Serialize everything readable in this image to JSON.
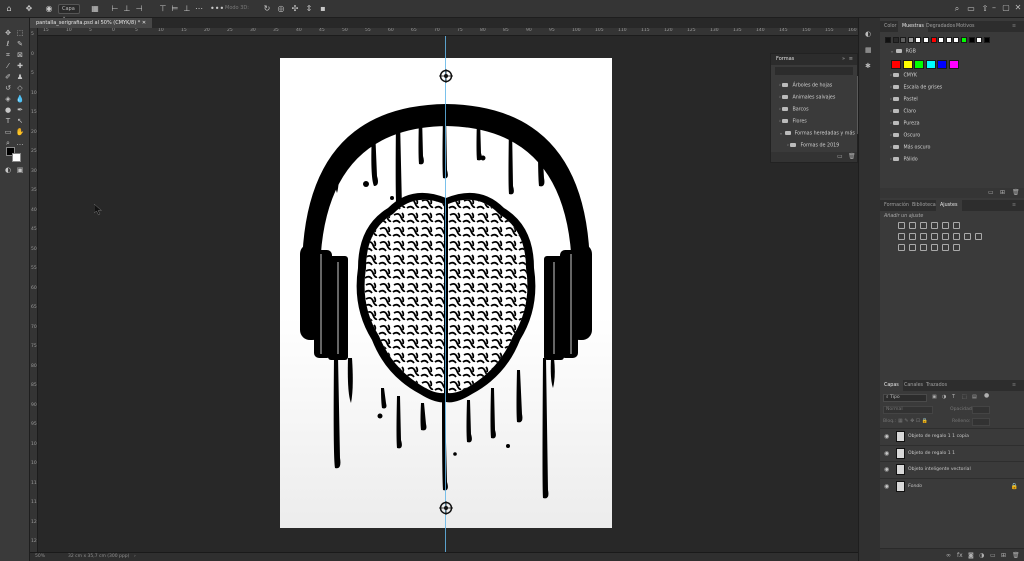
{
  "options_bar": {
    "layer_select": "Capa",
    "mode_3d": "Modo 3D:"
  },
  "document": {
    "tab_title": "pantalla_serigrafia.psd al 50% (CMYK/8) *",
    "zoom": "50%",
    "doc_info": "32 cm x 35,7 cm (300 ppp)"
  },
  "ruler_h": [
    "15",
    "10",
    "5",
    "0",
    "5",
    "10",
    "15",
    "20",
    "25",
    "30",
    "35",
    "40",
    "45",
    "50",
    "55",
    "60",
    "65",
    "70",
    "75",
    "80",
    "85",
    "90",
    "95",
    "100",
    "105",
    "110",
    "115",
    "120",
    "125",
    "130",
    "135",
    "140",
    "145",
    "150",
    "155",
    "160"
  ],
  "ruler_v": [
    "5",
    "0",
    "5",
    "10",
    "15",
    "20",
    "25",
    "30",
    "35",
    "40",
    "45",
    "50",
    "55",
    "60",
    "65",
    "70",
    "75",
    "80",
    "85",
    "90",
    "95",
    "100",
    "105",
    "110",
    "115",
    "120",
    "125"
  ],
  "formas_panel": {
    "title": "Formas",
    "items": [
      "Árboles de hojas",
      "Animales salvajes",
      "Barcos",
      "Flores",
      "Formas heredadas y más",
      "Formas de 2019"
    ]
  },
  "swatches_panel": {
    "tabs": [
      "Color",
      "Muestras",
      "Degradados",
      "Motivos"
    ],
    "active_tab": "Muestras",
    "recent_colors": [
      "#111111",
      "#2a2a2a",
      "#606060",
      "#9a9a9a",
      "#ffffff",
      "#ffffff",
      "#ff0000",
      "#ffffff",
      "#ffffff",
      "#ffffff",
      "#00ff00",
      "#000000",
      "#ffffff",
      "#000000"
    ],
    "rgb_group": "RGB",
    "rgb_colors": [
      "#ff0000",
      "#ffff00",
      "#00ff00",
      "#00ffff",
      "#0000ff",
      "#ff00ff"
    ],
    "groups": [
      "CMYK",
      "Escala de grises",
      "Pastel",
      "Claro",
      "Pureza",
      "Oscuro",
      "Más oscuro",
      "Pálido"
    ]
  },
  "adjust_panel": {
    "tabs": [
      "Formación",
      "Bibliotecas",
      "Ajustes"
    ],
    "active_tab": "Ajustes",
    "subtitle": "Añadir un ajuste"
  },
  "layers_panel": {
    "tabs": [
      "Capas",
      "Canales",
      "Trazados"
    ],
    "active_tab": "Capas",
    "filter": "Tipo",
    "blend_mode": "Normal",
    "opacity_label": "Opacidad:",
    "lock_label": "Bloq.:",
    "fill_label": "Relleno:",
    "layers": [
      {
        "name": "Objeto de regalo 1 1 copia",
        "italic": false
      },
      {
        "name": "Objeto de regalo 1 1",
        "italic": false
      },
      {
        "name": "Objeto inteligente vectorial",
        "italic": false
      },
      {
        "name": "Fondo",
        "italic": true
      }
    ]
  },
  "colors": {
    "accent": "#63b6e8",
    "panel_bg": "#3a3a3a",
    "workspace_bg": "#282828"
  }
}
